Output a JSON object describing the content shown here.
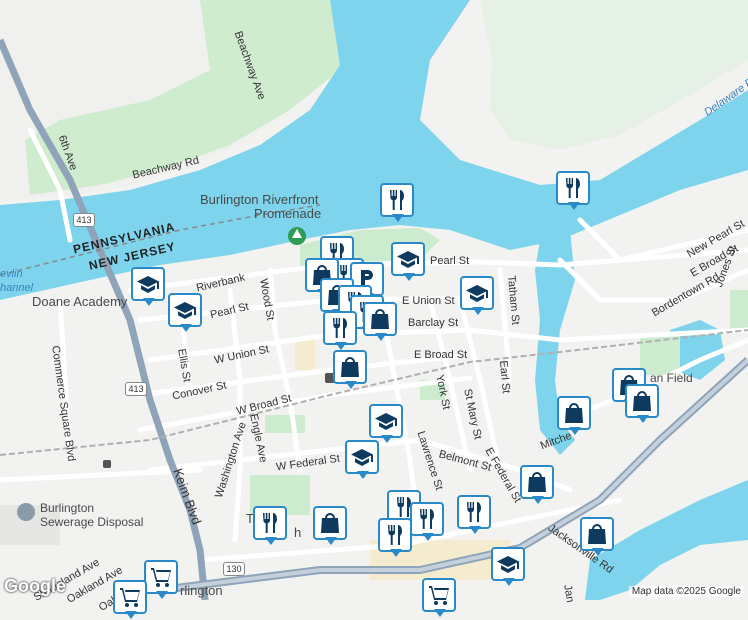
{
  "map": {
    "colors": {
      "water": "#7dd4ec",
      "land": "#f2f2f0",
      "park": "#cdeccf",
      "road": "#ffffff",
      "highway": "#8fa4b8",
      "pin_border": "#2a8ac9",
      "pin_icon": "#0d3a5e"
    },
    "labels": {
      "beachway_ave": "Beachway Ave",
      "beachway_rd": "Beachway Rd",
      "sixth_ave": "6th Ave",
      "riverfront_1": "Burlington Riverfront",
      "riverfront_2": "Promenade",
      "pennsylvania": "PENNSYLVANIA",
      "new_jersey": "NEW JERSEY",
      "levlin": "evlin",
      "channel": "hannel",
      "doane": "Doane Academy",
      "riverbank": "Riverbank",
      "pearl_st_w": "Pearl St",
      "pearl_st_e": "Pearl St",
      "new_pearl_st": "New Pearl St",
      "e_broad_st_ne": "E Broad St",
      "bordentown_rd": "Bordentown Rd",
      "jones_st": "Jones St",
      "delaware_river": "Delaware Riv",
      "wood_st": "Wood St",
      "ellis_st": "Ellis St",
      "w_union_st": "W Union St",
      "e_union_st": "E Union St",
      "barclay_st": "Barclay St",
      "e_broad_st": "E Broad St",
      "conover_st": "Conover St",
      "w_broad_st": "W Broad St",
      "commerce_sq": "Commerce Square Blvd",
      "washington_ave": "Washington Ave",
      "engle_ave": "Engle Ave",
      "w_federal_st": "W Federal St",
      "lawrence_st": "Lawrence St",
      "york_st": "York St",
      "st_mary_st": "St Mary St",
      "earl_st": "Earl St",
      "tatham_st": "Tatham St",
      "belmont_st": "Belmont St",
      "e_federal_st": "E Federal St",
      "keim_blvd": "Keim Blvd",
      "burlington_sewage_1": "Burlington",
      "burlington_sewage_2": "Sewerage Disposal",
      "mitche": "Mitche",
      "jacksonville_rd": "Jacksonville Rd",
      "jan": "Jan",
      "field": "an Field",
      "oakland_ave": "Oakland Ave",
      "shadeland_ave": "Shadeland Ave",
      "oakland_ave2": "Oakland Ave",
      "burlington_city": "rlington",
      "the_library": "Th",
      "the_library2": "h",
      "route_413_a": "413",
      "route_413_b": "413",
      "route_130": "130"
    },
    "attribution": "Map data ©2025 Google",
    "logo": "Google"
  }
}
